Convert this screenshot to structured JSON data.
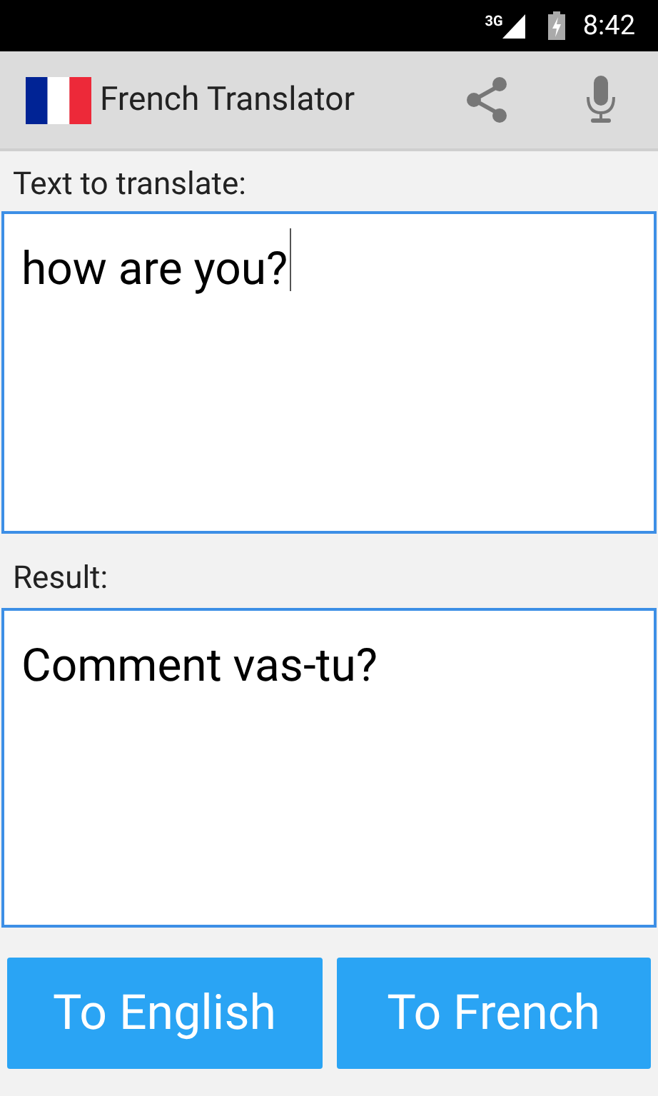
{
  "status_bar": {
    "network": "3G",
    "time": "8:42"
  },
  "app_bar": {
    "title": "French Translator"
  },
  "input": {
    "label": "Text to translate:",
    "value": "how are you?",
    "focused": true
  },
  "result": {
    "label": "Result:",
    "value": "Comment vas-tu?"
  },
  "buttons": [
    "To English",
    "To French"
  ]
}
